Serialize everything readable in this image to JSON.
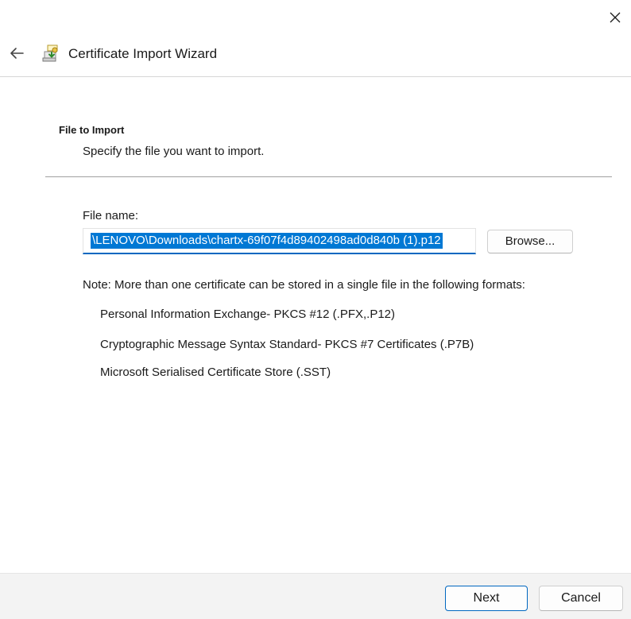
{
  "window": {
    "title": "Certificate Import Wizard",
    "close_icon": "close-icon",
    "back_icon": "back-arrow-icon",
    "wizard_icon": "certificate-wizard-icon"
  },
  "page": {
    "section_title": "File to Import",
    "section_subtitle": "Specify the file you want to import."
  },
  "file_field": {
    "label": "File name:",
    "value": "\\LENOVO\\Downloads\\chartx-69f07f4d89402498ad0d840b (1).p12",
    "selected": true
  },
  "browse_button": {
    "label": "Browse..."
  },
  "note": "Note:  More than one certificate can be stored in a single file in the following formats:",
  "formats": [
    "Personal Information Exchange- PKCS #12 (.PFX,.P12)",
    "Cryptographic Message Syntax Standard- PKCS #7 Certificates (.P7B)",
    "Microsoft Serialised Certificate Store (.SST)"
  ],
  "footer": {
    "next_label": "Next",
    "cancel_label": "Cancel"
  },
  "colors": {
    "accent": "#0067c0",
    "selection": "#0078d4",
    "footer_background": "#f3f3f3"
  }
}
